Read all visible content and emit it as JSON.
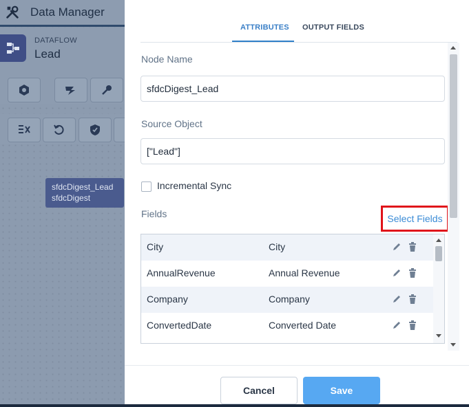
{
  "app": {
    "title": "Data Manager",
    "dataflow_kicker": "DATAFLOW",
    "dataflow_name": "Lead",
    "canvas_node": {
      "name": "sfdcDigest_Lead",
      "type": "sfdcDigest"
    },
    "toolbar_row1": [
      "sfdcdigest-icon",
      "augment-icon",
      "computeexpression-icon"
    ],
    "toolbar_row2": [
      "filter-icon",
      "undo-icon",
      "shield-icon"
    ]
  },
  "tabs": [
    {
      "label": "ATTRIBUTES",
      "active": true
    },
    {
      "label": "OUTPUT FIELDS",
      "active": false
    }
  ],
  "form": {
    "node_name_label": "Node Name",
    "node_name_value": "sfdcDigest_Lead",
    "source_object_label": "Source Object",
    "source_object_value": "[\"Lead\"]",
    "incremental_sync_label": "Incremental Sync",
    "incremental_sync_checked": false,
    "fields_label": "Fields",
    "select_fields_link": "Select Fields"
  },
  "fields_table": {
    "rows": [
      {
        "api": "City",
        "label": "City"
      },
      {
        "api": "AnnualRevenue",
        "label": "Annual Revenue"
      },
      {
        "api": "Company",
        "label": "Company"
      },
      {
        "api": "ConvertedDate",
        "label": "Converted Date"
      }
    ]
  },
  "footer": {
    "cancel_label": "Cancel",
    "save_label": "Save"
  },
  "colors": {
    "accent": "#2f7fc8",
    "save": "#57a8f2",
    "highlight": "#e0131a",
    "node": "#4a5b8e"
  }
}
